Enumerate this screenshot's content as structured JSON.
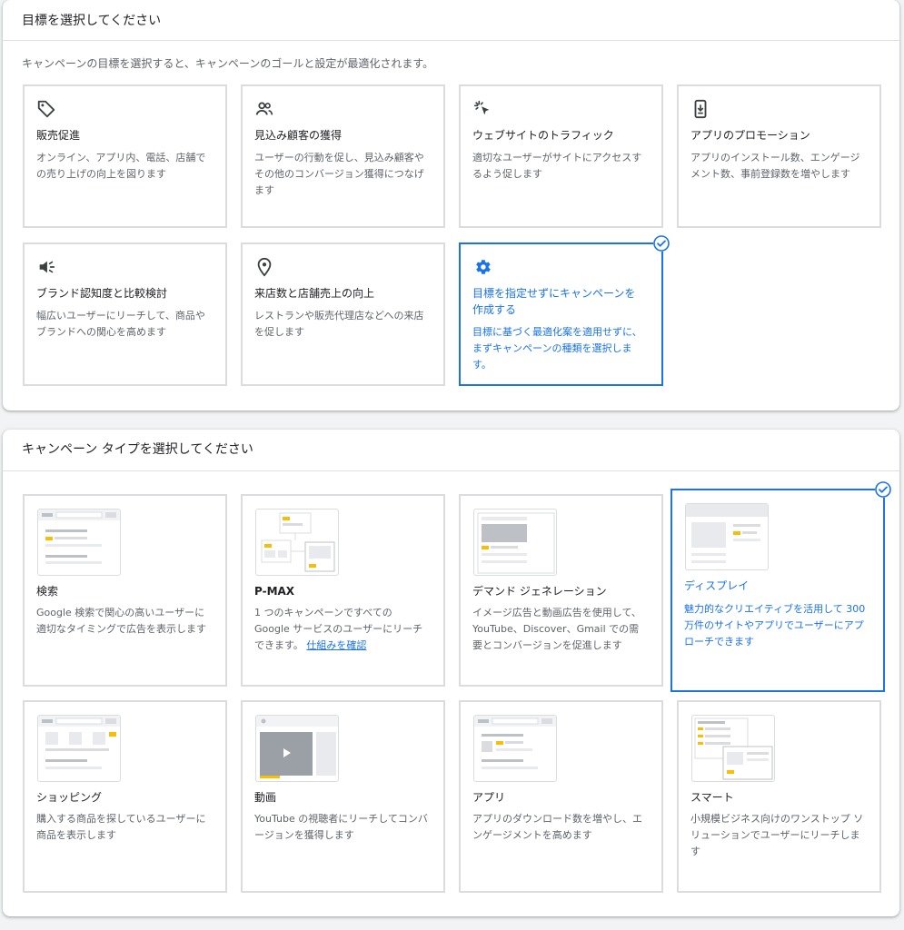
{
  "goal_section": {
    "title": "目標を選択してください",
    "description": "キャンペーンの目標を選択すると、キャンペーンのゴールと設定が最適化されます。",
    "cards": [
      {
        "title": "販売促進",
        "desc": "オンライン、アプリ内、電話、店舗での売り上げの向上を図ります",
        "icon": "tag-icon",
        "selected": false
      },
      {
        "title": "見込み顧客の獲得",
        "desc": "ユーザーの行動を促し、見込み顧客やその他のコンバージョン獲得につなげます",
        "icon": "people-icon",
        "selected": false
      },
      {
        "title": "ウェブサイトのトラフィック",
        "desc": "適切なユーザーがサイトにアクセスするよう促します",
        "icon": "cursor-click-icon",
        "selected": false
      },
      {
        "title": "アプリのプロモーション",
        "desc": "アプリのインストール数、エンゲージメント数、事前登録数を増やします",
        "icon": "phone-download-icon",
        "selected": false
      },
      {
        "title": "ブランド認知度と比較検討",
        "desc": "幅広いユーザーにリーチして、商品やブランドへの関心を高めます",
        "icon": "megaphone-icon",
        "selected": false
      },
      {
        "title": "来店数と店舗売上の向上",
        "desc": "レストランや販売代理店などへの来店を促します",
        "icon": "location-pin-icon",
        "selected": false
      },
      {
        "title": "目標を指定せずにキャンペーンを作成する",
        "desc": "目標に基づく最適化案を適用せずに、まずキャンペーンの種類を選択します。",
        "icon": "gear-icon",
        "selected": true
      }
    ]
  },
  "type_section": {
    "title": "キャンペーン タイプを選択してください",
    "cards": [
      {
        "title": "検索",
        "desc": "Google 検索で関心の高いユーザーに適切なタイミングで広告を表示します",
        "icon": "search-thumbnail-icon",
        "selected": false
      },
      {
        "title": "P-MAX",
        "desc": "1 つのキャンペーンですべての Google サービスのユーザーにリーチできます。",
        "link": "仕組みを確認",
        "icon": "pmax-thumbnail-icon",
        "selected": false
      },
      {
        "title": "デマンド ジェネレーション",
        "desc": "イメージ広告と動画広告を使用して、YouTube、Discover、Gmail での需要とコンバージョンを促進します",
        "icon": "demand-gen-thumbnail-icon",
        "selected": false
      },
      {
        "title": "ディスプレイ",
        "desc": "魅力的なクリエイティブを活用して 300 万件のサイトやアプリでユーザーにアプローチできます",
        "icon": "display-thumbnail-icon",
        "selected": true
      },
      {
        "title": "ショッピング",
        "desc": "購入する商品を探しているユーザーに商品を表示します",
        "icon": "shopping-thumbnail-icon",
        "selected": false
      },
      {
        "title": "動画",
        "desc": "YouTube の視聴者にリーチしてコンバージョンを獲得します",
        "icon": "video-thumbnail-icon",
        "selected": false
      },
      {
        "title": "アプリ",
        "desc": "アプリのダウンロード数を増やし、エンゲージメントを高めます",
        "icon": "app-thumbnail-icon",
        "selected": false
      },
      {
        "title": "スマート",
        "desc": "小規模ビジネス向けのワンストップ ソリューションでユーザーにリーチします",
        "icon": "smart-thumbnail-icon",
        "selected": false
      }
    ]
  },
  "colors": {
    "accent": "#1a73e8",
    "thumb_highlight": "#fbbc04",
    "border": "#dadce0"
  }
}
